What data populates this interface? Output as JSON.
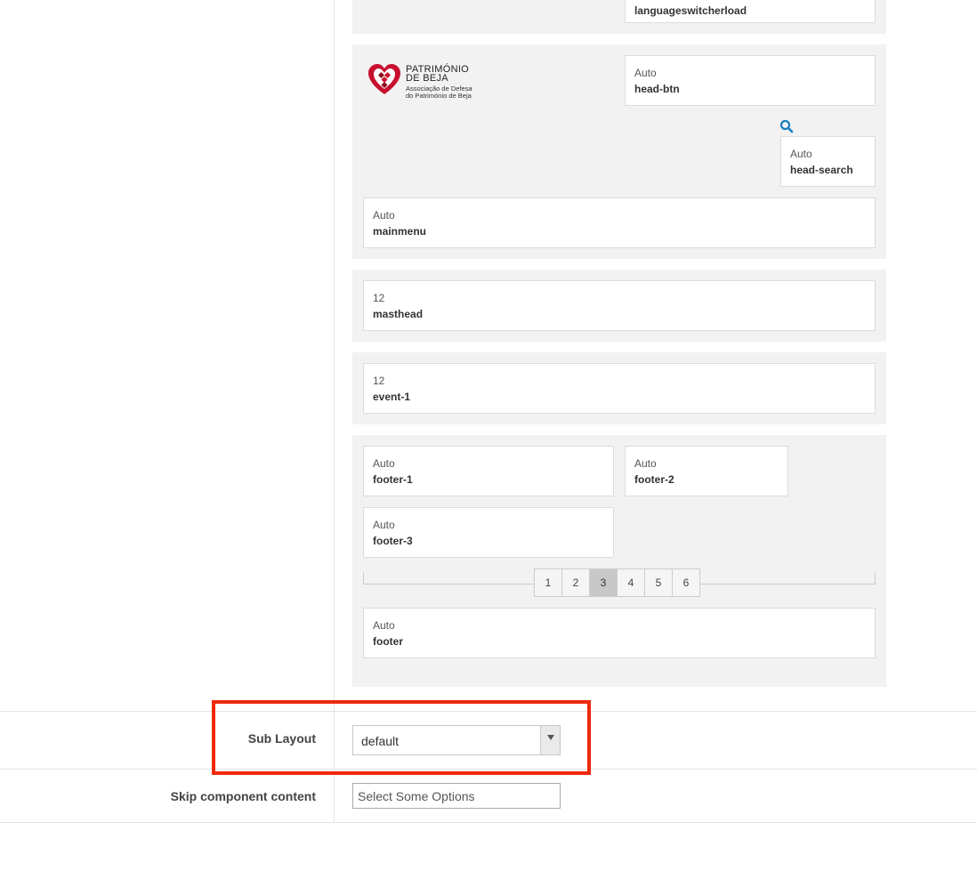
{
  "positions": {
    "languageswitcher": {
      "name": "languageswitcherload"
    },
    "head_btn": {
      "width": "Auto",
      "name": "head-btn"
    },
    "head_search": {
      "width": "Auto",
      "name": "head-search"
    },
    "mainmenu": {
      "width": "Auto",
      "name": "mainmenu"
    },
    "masthead": {
      "width": "12",
      "name": "masthead"
    },
    "event1": {
      "width": "12",
      "name": "event-1"
    },
    "footer1": {
      "width": "Auto",
      "name": "footer-1"
    },
    "footer2": {
      "width": "Auto",
      "name": "footer-2"
    },
    "footer3": {
      "width": "Auto",
      "name": "footer-3"
    },
    "footer": {
      "width": "Auto",
      "name": "footer"
    }
  },
  "logo": {
    "line1": "PATRIMÓNIO",
    "line2": "DE BEJA",
    "line3": "Associação de Defesa",
    "line4": "do Património de Beja",
    "colors": {
      "red": "#c8102e",
      "dark_red": "#8e0c1f"
    }
  },
  "footer_tabs": {
    "items": [
      "1",
      "2",
      "3",
      "4",
      "5",
      "6"
    ],
    "active": "3"
  },
  "search_icon": {
    "icon": "search-icon",
    "color": "#1a7fc1"
  },
  "form": {
    "sub_layout": {
      "label": "Sub Layout",
      "value": "default"
    },
    "skip_component": {
      "label": "Skip component content",
      "placeholder": "Select Some Options"
    }
  },
  "highlight_color": "#ee2a0b"
}
